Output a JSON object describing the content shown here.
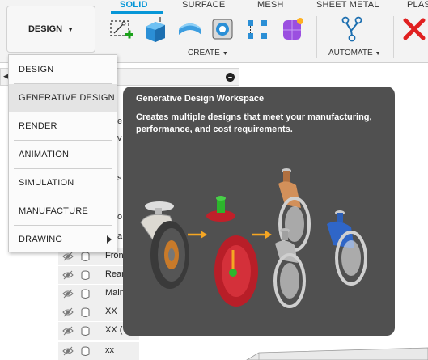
{
  "workspace_button": {
    "label": "DESIGN"
  },
  "tabs": [
    "SOLID",
    "SURFACE",
    "MESH",
    "SHEET METAL",
    "PLAS"
  ],
  "tool_groups": {
    "create": "CREATE",
    "automate": "AUTOMATE"
  },
  "tools": [
    "create-sketch-icon",
    "extrude-icon",
    "revolve-icon",
    "hole-icon",
    "pattern-icon",
    "form-icon",
    "automate-icon",
    "delete-icon"
  ],
  "menu": {
    "items": [
      {
        "label": "DESIGN"
      },
      {
        "label": "GENERATIVE DESIGN"
      },
      {
        "label": "RENDER"
      },
      {
        "label": "ANIMATION"
      },
      {
        "label": "SIMULATION"
      },
      {
        "label": "MANUFACTURE"
      },
      {
        "label": "DRAWING"
      }
    ]
  },
  "tooltip": {
    "title": "Generative Design Workspace",
    "description": "Creates multiple designs that meet your manufacturing, performance, and cost requirements."
  },
  "browser": {
    "rows": [
      {
        "label": "Fron"
      },
      {
        "label": "Rear"
      },
      {
        "label": "Main"
      },
      {
        "label": "XX"
      },
      {
        "label": "XX (1"
      },
      {
        "label": "xx"
      }
    ]
  },
  "colors": {
    "accent": "#0696d7",
    "tooltip_bg": "#505050",
    "delete": "#e02020"
  }
}
